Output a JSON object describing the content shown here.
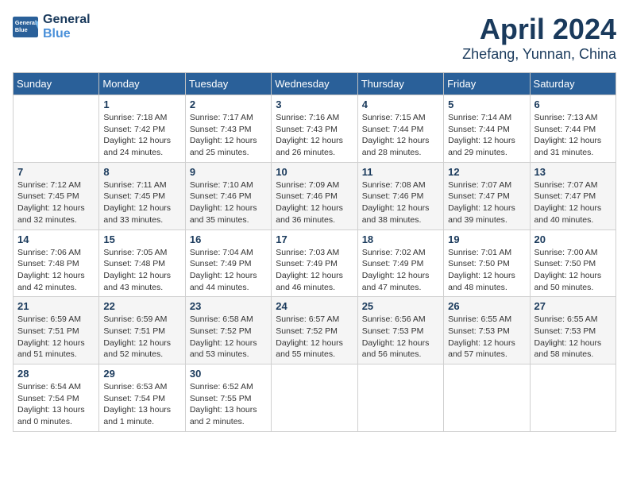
{
  "header": {
    "logo_line1": "General",
    "logo_line2": "Blue",
    "month_year": "April 2024",
    "location": "Zhefang, Yunnan, China"
  },
  "weekdays": [
    "Sunday",
    "Monday",
    "Tuesday",
    "Wednesday",
    "Thursday",
    "Friday",
    "Saturday"
  ],
  "weeks": [
    [
      {
        "day": "",
        "info": ""
      },
      {
        "day": "1",
        "info": "Sunrise: 7:18 AM\nSunset: 7:42 PM\nDaylight: 12 hours\nand 24 minutes."
      },
      {
        "day": "2",
        "info": "Sunrise: 7:17 AM\nSunset: 7:43 PM\nDaylight: 12 hours\nand 25 minutes."
      },
      {
        "day": "3",
        "info": "Sunrise: 7:16 AM\nSunset: 7:43 PM\nDaylight: 12 hours\nand 26 minutes."
      },
      {
        "day": "4",
        "info": "Sunrise: 7:15 AM\nSunset: 7:44 PM\nDaylight: 12 hours\nand 28 minutes."
      },
      {
        "day": "5",
        "info": "Sunrise: 7:14 AM\nSunset: 7:44 PM\nDaylight: 12 hours\nand 29 minutes."
      },
      {
        "day": "6",
        "info": "Sunrise: 7:13 AM\nSunset: 7:44 PM\nDaylight: 12 hours\nand 31 minutes."
      }
    ],
    [
      {
        "day": "7",
        "info": "Sunrise: 7:12 AM\nSunset: 7:45 PM\nDaylight: 12 hours\nand 32 minutes."
      },
      {
        "day": "8",
        "info": "Sunrise: 7:11 AM\nSunset: 7:45 PM\nDaylight: 12 hours\nand 33 minutes."
      },
      {
        "day": "9",
        "info": "Sunrise: 7:10 AM\nSunset: 7:46 PM\nDaylight: 12 hours\nand 35 minutes."
      },
      {
        "day": "10",
        "info": "Sunrise: 7:09 AM\nSunset: 7:46 PM\nDaylight: 12 hours\nand 36 minutes."
      },
      {
        "day": "11",
        "info": "Sunrise: 7:08 AM\nSunset: 7:46 PM\nDaylight: 12 hours\nand 38 minutes."
      },
      {
        "day": "12",
        "info": "Sunrise: 7:07 AM\nSunset: 7:47 PM\nDaylight: 12 hours\nand 39 minutes."
      },
      {
        "day": "13",
        "info": "Sunrise: 7:07 AM\nSunset: 7:47 PM\nDaylight: 12 hours\nand 40 minutes."
      }
    ],
    [
      {
        "day": "14",
        "info": "Sunrise: 7:06 AM\nSunset: 7:48 PM\nDaylight: 12 hours\nand 42 minutes."
      },
      {
        "day": "15",
        "info": "Sunrise: 7:05 AM\nSunset: 7:48 PM\nDaylight: 12 hours\nand 43 minutes."
      },
      {
        "day": "16",
        "info": "Sunrise: 7:04 AM\nSunset: 7:49 PM\nDaylight: 12 hours\nand 44 minutes."
      },
      {
        "day": "17",
        "info": "Sunrise: 7:03 AM\nSunset: 7:49 PM\nDaylight: 12 hours\nand 46 minutes."
      },
      {
        "day": "18",
        "info": "Sunrise: 7:02 AM\nSunset: 7:49 PM\nDaylight: 12 hours\nand 47 minutes."
      },
      {
        "day": "19",
        "info": "Sunrise: 7:01 AM\nSunset: 7:50 PM\nDaylight: 12 hours\nand 48 minutes."
      },
      {
        "day": "20",
        "info": "Sunrise: 7:00 AM\nSunset: 7:50 PM\nDaylight: 12 hours\nand 50 minutes."
      }
    ],
    [
      {
        "day": "21",
        "info": "Sunrise: 6:59 AM\nSunset: 7:51 PM\nDaylight: 12 hours\nand 51 minutes."
      },
      {
        "day": "22",
        "info": "Sunrise: 6:59 AM\nSunset: 7:51 PM\nDaylight: 12 hours\nand 52 minutes."
      },
      {
        "day": "23",
        "info": "Sunrise: 6:58 AM\nSunset: 7:52 PM\nDaylight: 12 hours\nand 53 minutes."
      },
      {
        "day": "24",
        "info": "Sunrise: 6:57 AM\nSunset: 7:52 PM\nDaylight: 12 hours\nand 55 minutes."
      },
      {
        "day": "25",
        "info": "Sunrise: 6:56 AM\nSunset: 7:53 PM\nDaylight: 12 hours\nand 56 minutes."
      },
      {
        "day": "26",
        "info": "Sunrise: 6:55 AM\nSunset: 7:53 PM\nDaylight: 12 hours\nand 57 minutes."
      },
      {
        "day": "27",
        "info": "Sunrise: 6:55 AM\nSunset: 7:53 PM\nDaylight: 12 hours\nand 58 minutes."
      }
    ],
    [
      {
        "day": "28",
        "info": "Sunrise: 6:54 AM\nSunset: 7:54 PM\nDaylight: 13 hours\nand 0 minutes."
      },
      {
        "day": "29",
        "info": "Sunrise: 6:53 AM\nSunset: 7:54 PM\nDaylight: 13 hours\nand 1 minute."
      },
      {
        "day": "30",
        "info": "Sunrise: 6:52 AM\nSunset: 7:55 PM\nDaylight: 13 hours\nand 2 minutes."
      },
      {
        "day": "",
        "info": ""
      },
      {
        "day": "",
        "info": ""
      },
      {
        "day": "",
        "info": ""
      },
      {
        "day": "",
        "info": ""
      }
    ]
  ]
}
